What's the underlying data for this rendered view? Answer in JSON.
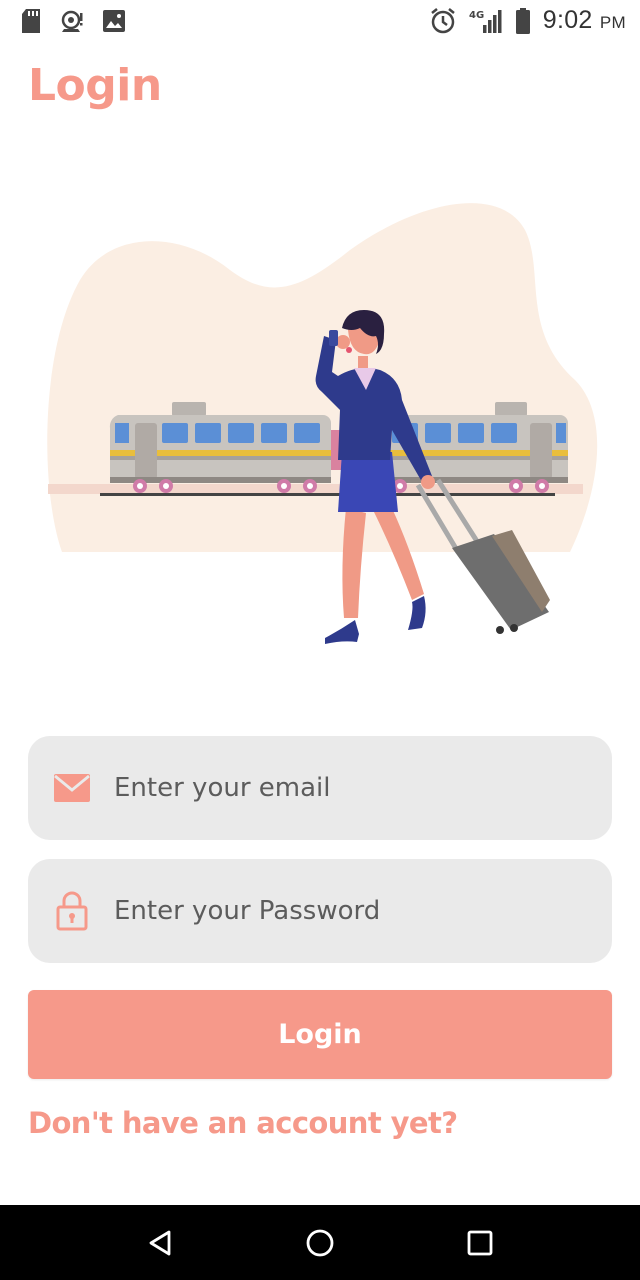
{
  "status_bar": {
    "time": "9:02",
    "ampm": "PM",
    "network": "4G",
    "left_icons": [
      "sd-card-icon",
      "hotspot-icon",
      "image-icon"
    ],
    "right_icons": [
      "alarm-icon",
      "signal-icon",
      "battery-icon"
    ]
  },
  "header": {
    "title": "Login"
  },
  "illustration": {
    "subject": "traveler-with-train-illustration"
  },
  "form": {
    "email": {
      "placeholder": "Enter your email",
      "value": "",
      "icon": "mail-icon"
    },
    "password": {
      "placeholder": "Enter your Password",
      "value": "",
      "icon": "lock-icon"
    },
    "login_label": "Login",
    "signup_prompt": "Don't have an account yet?"
  },
  "nav_bar": {
    "icons": [
      "back-icon",
      "home-icon",
      "recents-icon"
    ]
  },
  "colors": {
    "accent": "#F6998A",
    "field_bg": "#EAEAEA",
    "blob": "#FBEEE3",
    "suit": "#2E3A8C"
  }
}
